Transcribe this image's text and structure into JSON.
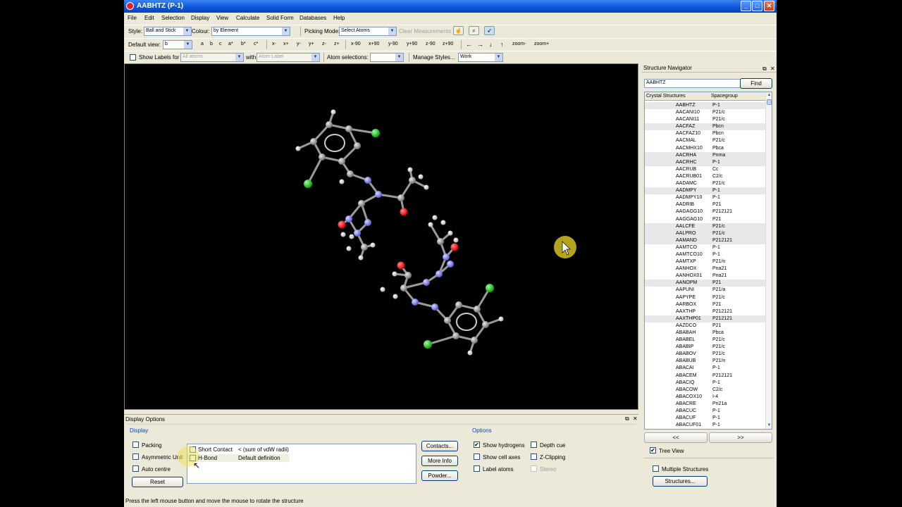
{
  "window": {
    "title": "AABHTZ (P-1)"
  },
  "menu": [
    "File",
    "Edit",
    "Selection",
    "Display",
    "View",
    "Calculate",
    "Solid Form",
    "Databases",
    "Help"
  ],
  "toolbar1": {
    "style_label": "Style:",
    "style_value": "Ball and Stick",
    "colour_label": "Colour:",
    "colour_value": "by Element",
    "picking_label": "Picking Mode:",
    "picking_value": "Select Atoms",
    "clear_label": "Clear Measurements"
  },
  "toolbar2": {
    "default_view_label": "Default view:",
    "default_view_value": "b",
    "axis_buttons": [
      "a",
      "b",
      "c",
      "a*",
      "b*",
      "c*"
    ],
    "rotate_buttons": [
      "x-",
      "x+",
      "y-",
      "y+",
      "z-",
      "z+"
    ],
    "angle_buttons": [
      "x-90",
      "x+90",
      "y-90",
      "y+90",
      "z-90",
      "z+90"
    ],
    "arrow_buttons": [
      "←",
      "→",
      "↓",
      "↑"
    ],
    "zoom_buttons": [
      "zoom-",
      "zoom+"
    ]
  },
  "toolbar3": {
    "show_labels_label": "Show Labels for",
    "labels_for_value": "All atoms",
    "with_label": "with",
    "with_value": "Atom Label",
    "atom_selections_label": "Atom selections:",
    "manage_styles_label": "Manage Styles...",
    "manage_styles_value": "Work"
  },
  "navigator": {
    "title": "Structure Navigator",
    "search_value": "AABHTZ",
    "find_label": "Find",
    "col_structures": "Crystal Structures",
    "col_spacegroup": "Spacegroup",
    "rows": [
      {
        "code": "AABHTZ",
        "sg": "P-1",
        "hl": true
      },
      {
        "code": "AACANI10",
        "sg": "P21/c",
        "hl": false
      },
      {
        "code": "AACANI11",
        "sg": "P21/c",
        "hl": false
      },
      {
        "code": "AACFAZ",
        "sg": "Pbcn",
        "hl": true
      },
      {
        "code": "AACFAZ10",
        "sg": "Pbcn",
        "hl": false
      },
      {
        "code": "AACMAL",
        "sg": "P21/c",
        "hl": false
      },
      {
        "code": "AACMHX10",
        "sg": "Pbca",
        "hl": false
      },
      {
        "code": "AACRHA",
        "sg": "Pnma",
        "hl": true
      },
      {
        "code": "AACRHC",
        "sg": "P-1",
        "hl": true
      },
      {
        "code": "AACRUB",
        "sg": "Cc",
        "hl": false
      },
      {
        "code": "AACRUB01",
        "sg": "C2/c",
        "hl": false
      },
      {
        "code": "AADAMC",
        "sg": "P21/c",
        "hl": false
      },
      {
        "code": "AADMPY",
        "sg": "P-1",
        "hl": true
      },
      {
        "code": "AADMPY10",
        "sg": "P-1",
        "hl": false
      },
      {
        "code": "AADRIB",
        "sg": "P21",
        "hl": false
      },
      {
        "code": "AAGAGG10",
        "sg": "P212121",
        "hl": false
      },
      {
        "code": "AAGGAG10",
        "sg": "P21",
        "hl": false
      },
      {
        "code": "AALCFE",
        "sg": "P21/c",
        "hl": true
      },
      {
        "code": "AALPRO",
        "sg": "P21/c",
        "hl": true
      },
      {
        "code": "AAMAND",
        "sg": "P212121",
        "hl": true
      },
      {
        "code": "AAMTCO",
        "sg": "P-1",
        "hl": false
      },
      {
        "code": "AAMTCO10",
        "sg": "P-1",
        "hl": false
      },
      {
        "code": "AAMTXP",
        "sg": "P21/n",
        "hl": false
      },
      {
        "code": "AANHOX",
        "sg": "Pna21",
        "hl": false
      },
      {
        "code": "AANHOX01",
        "sg": "Pna21",
        "hl": false
      },
      {
        "code": "AANOPM",
        "sg": "P21",
        "hl": true
      },
      {
        "code": "AAPUNI",
        "sg": "P21/a",
        "hl": false
      },
      {
        "code": "AAPYPE",
        "sg": "P21/c",
        "hl": false
      },
      {
        "code": "AARBOX",
        "sg": "P21",
        "hl": false
      },
      {
        "code": "AAXTHP",
        "sg": "P212121",
        "hl": false
      },
      {
        "code": "AAXTHP01",
        "sg": "P212121",
        "hl": true
      },
      {
        "code": "AAZDCO",
        "sg": "P21",
        "hl": false
      },
      {
        "code": "ABABAH",
        "sg": "Pbca",
        "hl": false
      },
      {
        "code": "ABABEL",
        "sg": "P21/c",
        "hl": false
      },
      {
        "code": "ABABIP",
        "sg": "P21/c",
        "hl": false
      },
      {
        "code": "ABABOV",
        "sg": "P21/c",
        "hl": false
      },
      {
        "code": "ABABUB",
        "sg": "P21/n",
        "hl": false
      },
      {
        "code": "ABACAI",
        "sg": "P-1",
        "hl": false
      },
      {
        "code": "ABACEM",
        "sg": "P212121",
        "hl": false
      },
      {
        "code": "ABACIQ",
        "sg": "P-1",
        "hl": false
      },
      {
        "code": "ABACOW",
        "sg": "C2/c",
        "hl": false
      },
      {
        "code": "ABACOX10",
        "sg": "I-4",
        "hl": false
      },
      {
        "code": "ABACRE",
        "sg": "Pn21a",
        "hl": false
      },
      {
        "code": "ABACUC",
        "sg": "P-1",
        "hl": false
      },
      {
        "code": "ABACUF",
        "sg": "P-1",
        "hl": false
      },
      {
        "code": "ABACUF01",
        "sg": "P-1",
        "hl": false
      }
    ],
    "prev_label": "<<",
    "next_label": ">>",
    "tree_view_label": "Tree View",
    "multiple_label": "Multiple Structures",
    "structures_button": "Structures..."
  },
  "display_options": {
    "title": "Display Options",
    "display_group": "Display",
    "packing": "Packing",
    "asym_unit": "Asymmetric Unit",
    "auto_centre": "Auto centre",
    "reset": "Reset",
    "contacts": [
      {
        "name": "Short Contact",
        "def": "< (sum of vdW radii)"
      },
      {
        "name": "H-Bond",
        "def": "Default definition"
      }
    ],
    "contacts_button": "Contacts...",
    "more_info_button": "More Info",
    "powder_button": "Powder...",
    "options_group": "Options",
    "show_hydrogens": "Show hydrogens",
    "show_cell_axes": "Show cell axes",
    "label_atoms": "Label atoms",
    "depth_cue": "Depth cue",
    "z_clipping": "Z-Clipping",
    "stereo": "Stereo"
  },
  "status": "Press the left mouse button and move the mouse to rotate the structure",
  "colors": {
    "carbon": "#9a9a9a",
    "nitrogen": "#8888ee",
    "oxygen": "#ee1111",
    "chlorine": "#22cc22",
    "hydrogen": "#ffffff"
  }
}
